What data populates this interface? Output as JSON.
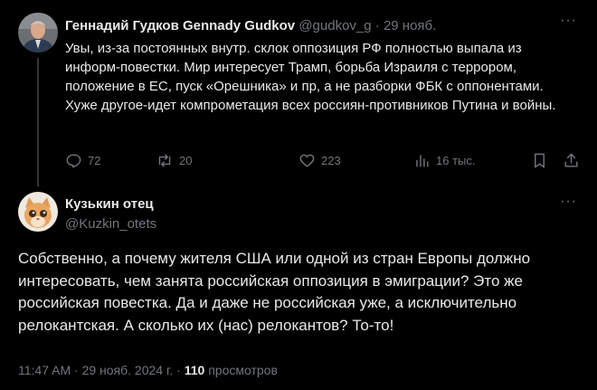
{
  "parent_tweet": {
    "display_name": "Геннадий Гудков Gennady Gudkov",
    "handle": "@gudkov_g",
    "separator": "·",
    "date": "29 нояб.",
    "more_label": "···",
    "text": "Увы, из-за постоянных внутр. склок оппозиция РФ полностью выпала из информ-повестки. Мир интересует Трамп, борьба Израиля с террором, положение в ЕС, пуск «Орешника» и пр, а не разборки ФБК с оппонентами. Хуже другое-идет компрометация всех россиян-противников Путина и войны.",
    "stats": {
      "replies": "72",
      "reposts": "20",
      "likes": "223",
      "views": "16 тыс."
    }
  },
  "reply_tweet": {
    "display_name": "Кузькин отец",
    "handle": "@Kuzkin_otets",
    "more_label": "···",
    "text": "Собственно, а почему жителя США или одной из стран Европы должно интересовать, чем занята российская оппозиция в эмиграции? Это же российская повестка. Да и даже не российская уже, а исключительно релокантская. А сколько их (нас) релокантов? То-то!",
    "time": "11:47 AM",
    "separator": "·",
    "date": "29 нояб. 2024 г.",
    "separator2": "·",
    "views_count": "110",
    "views_label": "просмотров"
  },
  "colors": {
    "background": "#000000",
    "text": "#e7e9ea",
    "muted": "#71767b",
    "thread_line": "#333639"
  }
}
